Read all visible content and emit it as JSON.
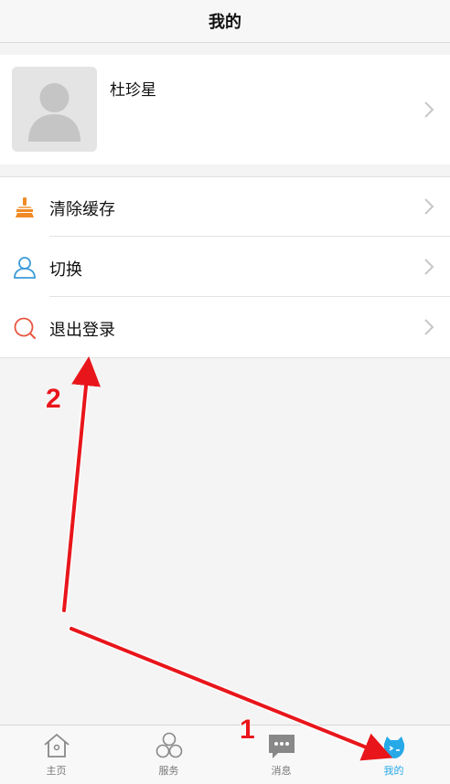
{
  "header": {
    "title": "我的"
  },
  "profile": {
    "name": "杜珍星"
  },
  "menu": {
    "items": [
      {
        "label": "清除缓存",
        "icon": "broom-icon"
      },
      {
        "label": "切换",
        "icon": "user-switch-icon"
      },
      {
        "label": "退出登录",
        "icon": "logout-icon"
      }
    ]
  },
  "tabbar": {
    "items": [
      {
        "label": "主页",
        "icon": "home-icon"
      },
      {
        "label": "服务",
        "icon": "services-icon"
      },
      {
        "label": "消息",
        "icon": "message-icon"
      },
      {
        "label": "我的",
        "icon": "profile-icon",
        "active": true
      }
    ]
  },
  "annotations": {
    "step1": "1",
    "step2": "2"
  },
  "colors": {
    "accent": "#27a9e8",
    "annotation": "#e8161b",
    "broom": "#f08a24",
    "logout": "#e8553f"
  }
}
